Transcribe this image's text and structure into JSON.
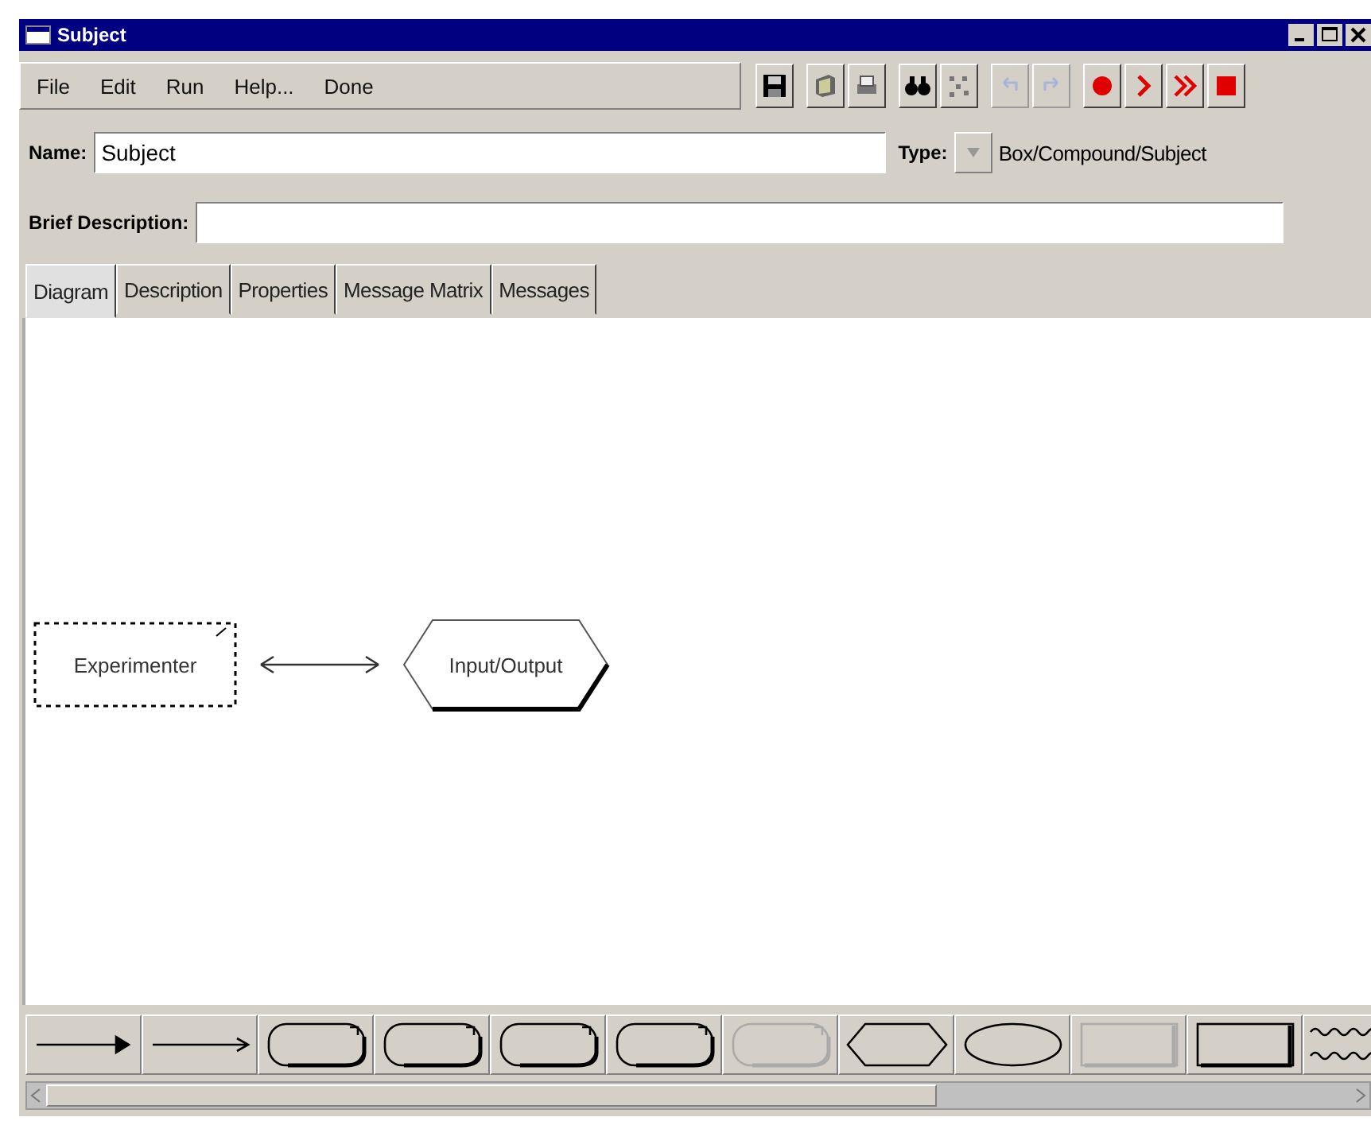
{
  "window": {
    "title": "Subject"
  },
  "menu": [
    "File",
    "Edit",
    "Run",
    "Help...",
    "Done"
  ],
  "toolbar": [
    {
      "kind": "save",
      "disabled": false
    },
    {
      "kind": "notes",
      "disabled": false
    },
    {
      "kind": "print",
      "disabled": false
    },
    {
      "kind": "find",
      "disabled": false
    },
    {
      "kind": "layout",
      "disabled": false
    },
    {
      "kind": "undo",
      "disabled": true
    },
    {
      "kind": "redo",
      "disabled": true
    },
    {
      "kind": "record",
      "disabled": false
    },
    {
      "kind": "step",
      "disabled": false
    },
    {
      "kind": "run",
      "disabled": false
    },
    {
      "kind": "stop",
      "disabled": false
    }
  ],
  "name_field": {
    "label": "Name:",
    "value": "Subject"
  },
  "type_field": {
    "label": "Type:",
    "value": "Box/Compound/Subject"
  },
  "brief_description": {
    "label": "Brief Description:"
  },
  "tabs": [
    {
      "label": "Diagram",
      "selected": true
    },
    {
      "label": "Description",
      "selected": false
    },
    {
      "label": "Properties",
      "selected": false
    },
    {
      "label": "Message Matrix",
      "selected": false
    },
    {
      "label": "Messages",
      "selected": false
    }
  ],
  "diagram": {
    "nodes": [
      {
        "kind": "box",
        "label": "Experimenter",
        "selected": true
      },
      {
        "kind": "hexagon",
        "label": "Input/Output",
        "selected": false
      }
    ],
    "connector": {
      "kind": "double-arrow"
    }
  },
  "palette": [
    {
      "kind": "line-filled-head",
      "disabled": false
    },
    {
      "kind": "line-open-head",
      "disabled": false
    },
    {
      "kind": "rounded",
      "disabled": false
    },
    {
      "kind": "rounded",
      "disabled": false
    },
    {
      "kind": "rounded",
      "disabled": false
    },
    {
      "kind": "rounded",
      "disabled": false
    },
    {
      "kind": "rounded",
      "disabled": true
    },
    {
      "kind": "hexagon",
      "disabled": false
    },
    {
      "kind": "ellipse",
      "disabled": false
    },
    {
      "kind": "rect",
      "disabled": true
    },
    {
      "kind": "rect",
      "disabled": false
    },
    {
      "kind": "wave",
      "disabled": false
    }
  ]
}
